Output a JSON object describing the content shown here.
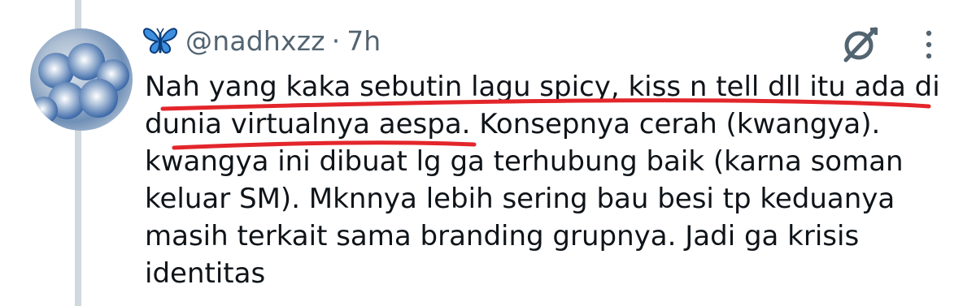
{
  "tweet": {
    "author": {
      "emoji": "🦋",
      "handle": "@nadhxzz",
      "separator": "·",
      "time": "7h"
    },
    "text_lines": [
      "Nah yang kaka sebutin lagu spicy, kiss n tell dll itu ada di",
      "dunia virtualnya aespa. Konsepnya cerah (kwangya).",
      "kwangya ini dibuat lg ga terhubung baik (karna soman",
      "keluar SM). Mknnya lebih sering bau besi tp keduanya",
      "masih terkait sama branding grupnya. Jadi ga krisis",
      "identitas"
    ],
    "icons": [
      "butterfly-icon",
      "grok-icon",
      "more-options-icon"
    ],
    "colors": {
      "text": "#0f1419",
      "secondary": "#536471",
      "thread_line": "#cfd9de",
      "annotation": "#e3262b"
    }
  }
}
